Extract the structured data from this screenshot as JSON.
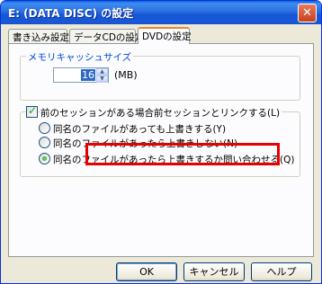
{
  "window": {
    "title": "E: (DATA DISC) の設定",
    "close_label": "✕"
  },
  "tabs": [
    {
      "label": "書き込み設定",
      "active": false
    },
    {
      "label": "データCDの設定",
      "active": false
    },
    {
      "label": "DVDの設定",
      "active": true
    }
  ],
  "memory_cache": {
    "group_label": "メモリキャッシュサイズ",
    "value": "16",
    "unit": "(MB)"
  },
  "link_session": {
    "checkbox_label": "前のセッションがある場合前セッションとリンクする(L)",
    "checked": true,
    "options": [
      {
        "label": "同名のファイルがあっても上書きする(Y)",
        "selected": false
      },
      {
        "label": "同名のファイルがあったら上書きしない(N)",
        "selected": false
      },
      {
        "label": "同名のファイルがあったら上書きするか問い合わせる(Q)",
        "selected": true
      }
    ]
  },
  "buttons": {
    "ok": "OK",
    "cancel": "キャンセル",
    "help": "ヘルプ"
  },
  "colors": {
    "highlight": "#e60000",
    "group_label": "#0046d5"
  }
}
